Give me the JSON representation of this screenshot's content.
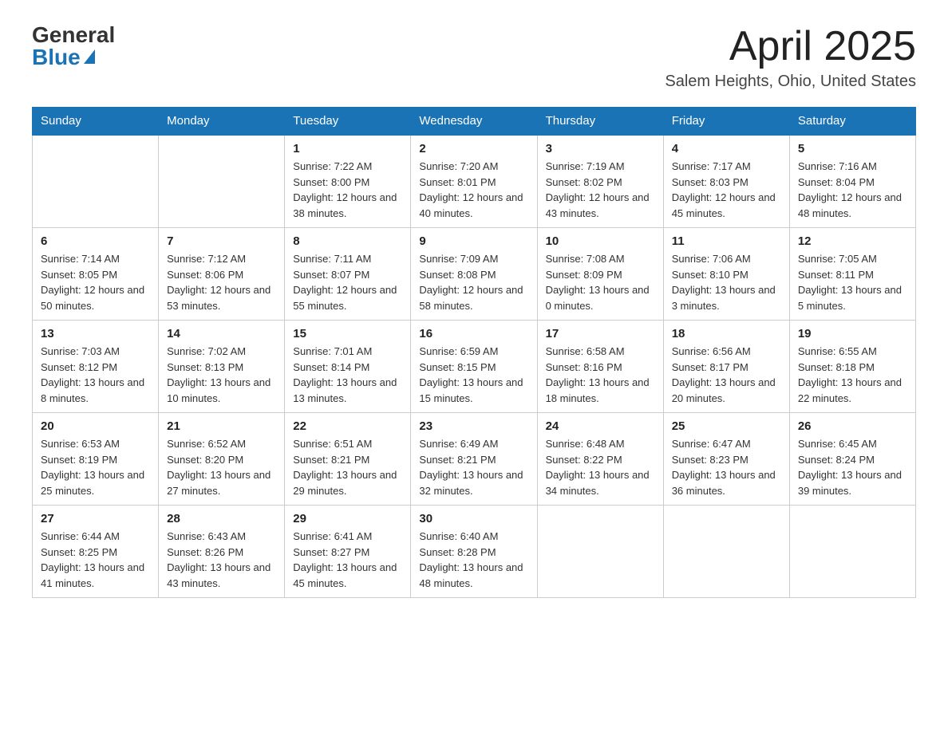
{
  "logo": {
    "general": "General",
    "blue": "Blue"
  },
  "header": {
    "month": "April 2025",
    "location": "Salem Heights, Ohio, United States"
  },
  "days_of_week": [
    "Sunday",
    "Monday",
    "Tuesday",
    "Wednesday",
    "Thursday",
    "Friday",
    "Saturday"
  ],
  "weeks": [
    [
      {
        "day": "",
        "sunrise": "",
        "sunset": "",
        "daylight": ""
      },
      {
        "day": "",
        "sunrise": "",
        "sunset": "",
        "daylight": ""
      },
      {
        "day": "1",
        "sunrise": "Sunrise: 7:22 AM",
        "sunset": "Sunset: 8:00 PM",
        "daylight": "Daylight: 12 hours and 38 minutes."
      },
      {
        "day": "2",
        "sunrise": "Sunrise: 7:20 AM",
        "sunset": "Sunset: 8:01 PM",
        "daylight": "Daylight: 12 hours and 40 minutes."
      },
      {
        "day": "3",
        "sunrise": "Sunrise: 7:19 AM",
        "sunset": "Sunset: 8:02 PM",
        "daylight": "Daylight: 12 hours and 43 minutes."
      },
      {
        "day": "4",
        "sunrise": "Sunrise: 7:17 AM",
        "sunset": "Sunset: 8:03 PM",
        "daylight": "Daylight: 12 hours and 45 minutes."
      },
      {
        "day": "5",
        "sunrise": "Sunrise: 7:16 AM",
        "sunset": "Sunset: 8:04 PM",
        "daylight": "Daylight: 12 hours and 48 minutes."
      }
    ],
    [
      {
        "day": "6",
        "sunrise": "Sunrise: 7:14 AM",
        "sunset": "Sunset: 8:05 PM",
        "daylight": "Daylight: 12 hours and 50 minutes."
      },
      {
        "day": "7",
        "sunrise": "Sunrise: 7:12 AM",
        "sunset": "Sunset: 8:06 PM",
        "daylight": "Daylight: 12 hours and 53 minutes."
      },
      {
        "day": "8",
        "sunrise": "Sunrise: 7:11 AM",
        "sunset": "Sunset: 8:07 PM",
        "daylight": "Daylight: 12 hours and 55 minutes."
      },
      {
        "day": "9",
        "sunrise": "Sunrise: 7:09 AM",
        "sunset": "Sunset: 8:08 PM",
        "daylight": "Daylight: 12 hours and 58 minutes."
      },
      {
        "day": "10",
        "sunrise": "Sunrise: 7:08 AM",
        "sunset": "Sunset: 8:09 PM",
        "daylight": "Daylight: 13 hours and 0 minutes."
      },
      {
        "day": "11",
        "sunrise": "Sunrise: 7:06 AM",
        "sunset": "Sunset: 8:10 PM",
        "daylight": "Daylight: 13 hours and 3 minutes."
      },
      {
        "day": "12",
        "sunrise": "Sunrise: 7:05 AM",
        "sunset": "Sunset: 8:11 PM",
        "daylight": "Daylight: 13 hours and 5 minutes."
      }
    ],
    [
      {
        "day": "13",
        "sunrise": "Sunrise: 7:03 AM",
        "sunset": "Sunset: 8:12 PM",
        "daylight": "Daylight: 13 hours and 8 minutes."
      },
      {
        "day": "14",
        "sunrise": "Sunrise: 7:02 AM",
        "sunset": "Sunset: 8:13 PM",
        "daylight": "Daylight: 13 hours and 10 minutes."
      },
      {
        "day": "15",
        "sunrise": "Sunrise: 7:01 AM",
        "sunset": "Sunset: 8:14 PM",
        "daylight": "Daylight: 13 hours and 13 minutes."
      },
      {
        "day": "16",
        "sunrise": "Sunrise: 6:59 AM",
        "sunset": "Sunset: 8:15 PM",
        "daylight": "Daylight: 13 hours and 15 minutes."
      },
      {
        "day": "17",
        "sunrise": "Sunrise: 6:58 AM",
        "sunset": "Sunset: 8:16 PM",
        "daylight": "Daylight: 13 hours and 18 minutes."
      },
      {
        "day": "18",
        "sunrise": "Sunrise: 6:56 AM",
        "sunset": "Sunset: 8:17 PM",
        "daylight": "Daylight: 13 hours and 20 minutes."
      },
      {
        "day": "19",
        "sunrise": "Sunrise: 6:55 AM",
        "sunset": "Sunset: 8:18 PM",
        "daylight": "Daylight: 13 hours and 22 minutes."
      }
    ],
    [
      {
        "day": "20",
        "sunrise": "Sunrise: 6:53 AM",
        "sunset": "Sunset: 8:19 PM",
        "daylight": "Daylight: 13 hours and 25 minutes."
      },
      {
        "day": "21",
        "sunrise": "Sunrise: 6:52 AM",
        "sunset": "Sunset: 8:20 PM",
        "daylight": "Daylight: 13 hours and 27 minutes."
      },
      {
        "day": "22",
        "sunrise": "Sunrise: 6:51 AM",
        "sunset": "Sunset: 8:21 PM",
        "daylight": "Daylight: 13 hours and 29 minutes."
      },
      {
        "day": "23",
        "sunrise": "Sunrise: 6:49 AM",
        "sunset": "Sunset: 8:21 PM",
        "daylight": "Daylight: 13 hours and 32 minutes."
      },
      {
        "day": "24",
        "sunrise": "Sunrise: 6:48 AM",
        "sunset": "Sunset: 8:22 PM",
        "daylight": "Daylight: 13 hours and 34 minutes."
      },
      {
        "day": "25",
        "sunrise": "Sunrise: 6:47 AM",
        "sunset": "Sunset: 8:23 PM",
        "daylight": "Daylight: 13 hours and 36 minutes."
      },
      {
        "day": "26",
        "sunrise": "Sunrise: 6:45 AM",
        "sunset": "Sunset: 8:24 PM",
        "daylight": "Daylight: 13 hours and 39 minutes."
      }
    ],
    [
      {
        "day": "27",
        "sunrise": "Sunrise: 6:44 AM",
        "sunset": "Sunset: 8:25 PM",
        "daylight": "Daylight: 13 hours and 41 minutes."
      },
      {
        "day": "28",
        "sunrise": "Sunrise: 6:43 AM",
        "sunset": "Sunset: 8:26 PM",
        "daylight": "Daylight: 13 hours and 43 minutes."
      },
      {
        "day": "29",
        "sunrise": "Sunrise: 6:41 AM",
        "sunset": "Sunset: 8:27 PM",
        "daylight": "Daylight: 13 hours and 45 minutes."
      },
      {
        "day": "30",
        "sunrise": "Sunrise: 6:40 AM",
        "sunset": "Sunset: 8:28 PM",
        "daylight": "Daylight: 13 hours and 48 minutes."
      },
      {
        "day": "",
        "sunrise": "",
        "sunset": "",
        "daylight": ""
      },
      {
        "day": "",
        "sunrise": "",
        "sunset": "",
        "daylight": ""
      },
      {
        "day": "",
        "sunrise": "",
        "sunset": "",
        "daylight": ""
      }
    ]
  ]
}
